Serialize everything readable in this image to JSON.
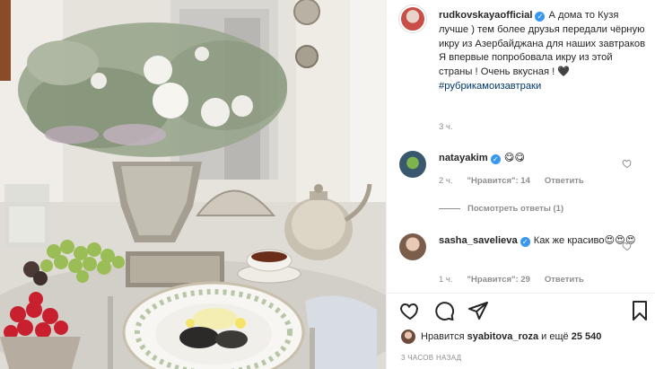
{
  "post": {
    "author": "rudkovskayaofficial",
    "caption_line1": "А дома то Кузя лучше ) тем более друзья передали чёрную икру из Азербайджана для наших завтраков",
    "caption_line2": "Я впервые попробовала икру из этой страны ! Очень вкусная ! 🖤",
    "hashtag": "#рубрикамоизавтраки",
    "time": "3 ч."
  },
  "comments": [
    {
      "user": "natayakim",
      "text": "😋😋",
      "time": "2 ч.",
      "likes": "\"Нравится\": 14",
      "reply": "Ответить",
      "view_replies": "Посмотреть ответы (1)"
    },
    {
      "user": "sasha_savelieva",
      "text": "Как же красиво😍😍😍",
      "time": "1 ч.",
      "likes": "\"Нравится\": 29",
      "reply": "Ответить"
    }
  ],
  "footer": {
    "liked_by_prefix": "Нравится",
    "liked_by_user": "syabitova_roza",
    "liked_by_suffix": "и ещё",
    "liked_by_count": "25 540",
    "posted_ago": "3 ЧАСОВ НАЗАД"
  },
  "colors": {
    "verified": "#3897f0",
    "secondary_text": "#8e8e8e",
    "hashtag": "#00376b"
  },
  "icons": {
    "like": "heart-icon",
    "comment": "comment-icon",
    "share": "paper-plane-icon",
    "save": "bookmark-icon",
    "verified": "verified-badge-icon"
  }
}
